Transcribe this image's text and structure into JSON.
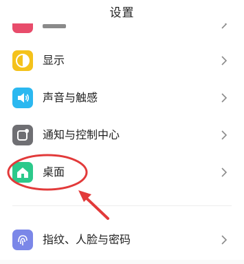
{
  "header": {
    "title": "设置"
  },
  "settings": {
    "items": [
      {
        "label": "显示",
        "icon": "display-icon",
        "color": "#F4C21B"
      },
      {
        "label": "声音与触感",
        "icon": "speaker-icon",
        "color": "#2BB8F0"
      },
      {
        "label": "通知与控制中心",
        "icon": "notification-icon",
        "color": "#6F6F73"
      },
      {
        "label": "桌面",
        "icon": "home-icon",
        "color": "#2CC98B"
      },
      {
        "label": "指纹、人脸与密码",
        "icon": "fingerprint-icon",
        "color": "#7B87E8"
      }
    ]
  },
  "annotation": {
    "color": "#E23A3A"
  },
  "top_partial_icon_color": "#E84C6B"
}
